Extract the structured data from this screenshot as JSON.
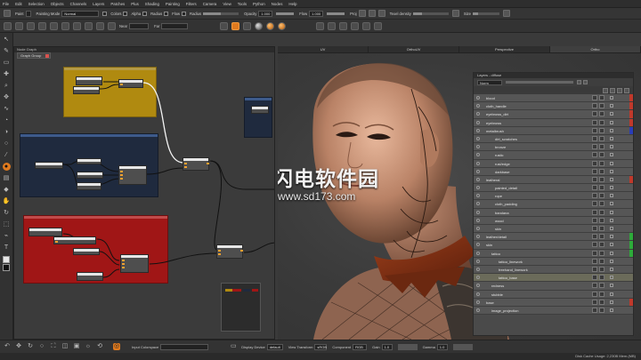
{
  "menu": [
    "File",
    "Edit",
    "Selection",
    "Objects",
    "Channels",
    "Layers",
    "Patches",
    "Plus",
    "Shading",
    "Painting",
    "Filters",
    "Camera",
    "View",
    "Tools",
    "Python",
    "Nodes",
    "Help"
  ],
  "toolbar": {
    "paint_label": "Paint",
    "paint_mode_label": "Painting Mode",
    "paint_mode_value": "Normal",
    "colors_label": "Colors",
    "alpha_label": "Alpha",
    "radius_label": "Radius",
    "flow_label": "Flow",
    "radius2_label": "Radius",
    "opacity_label": "Opacity",
    "opacity_value": "1.000",
    "flow2_label": "Flow",
    "flow_value": "1.000",
    "proj_label": "Proj",
    "texel_label": "Texel density",
    "size_label": "Size",
    "row2_labels": [
      "Near",
      "Far"
    ]
  },
  "graph": {
    "panel_title": "Node Graph",
    "tab_label": "Graph Group"
  },
  "viewport_tabs": [
    "UV",
    "OrthoUV",
    "Perspective",
    "Ortho"
  ],
  "layers_panel": {
    "title": "Layers - diffuse",
    "mode_value": "Norm",
    "rows": [
      {
        "name": "blood",
        "indent": 4,
        "strip": "#c0392b"
      },
      {
        "name": "cloth_handle",
        "indent": 4,
        "strip": "#c0392b"
      },
      {
        "name": "eyebrows_dirt",
        "indent": 4,
        "strip": "#c0392b"
      },
      {
        "name": "eyebrows",
        "indent": 4,
        "strip": "#c0392b"
      },
      {
        "name": "metalbrush",
        "indent": 4,
        "strip": "#2a3db8"
      },
      {
        "name": "dirt_scratches",
        "indent": 14,
        "strip": ""
      },
      {
        "name": "bronze",
        "indent": 14,
        "strip": ""
      },
      {
        "name": "rustic",
        "indent": 14,
        "strip": ""
      },
      {
        "name": "rust/edge",
        "indent": 14,
        "strip": ""
      },
      {
        "name": "darkbase",
        "indent": 14,
        "strip": ""
      },
      {
        "name": "leatheral",
        "indent": 4,
        "strip": "#c0392b"
      },
      {
        "name": "painted_detail",
        "indent": 14,
        "strip": ""
      },
      {
        "name": "rope",
        "indent": 14,
        "strip": ""
      },
      {
        "name": "cloth_padding",
        "indent": 14,
        "strip": ""
      },
      {
        "name": "bandana",
        "indent": 14,
        "strip": ""
      },
      {
        "name": "wood",
        "indent": 14,
        "strip": ""
      },
      {
        "name": "skin",
        "indent": 14,
        "strip": ""
      },
      {
        "name": "leather/detail",
        "indent": 4,
        "strip": "#2eaa3a"
      },
      {
        "name": "skin",
        "indent": 4,
        "strip": "#2eaa3a"
      },
      {
        "name": "tattoo",
        "indent": 10,
        "strip": "#2eaa3a"
      },
      {
        "name": "tattoo_linework",
        "indent": 18,
        "strip": ""
      },
      {
        "name": "freehand_linework",
        "indent": 18,
        "strip": ""
      },
      {
        "name": "tattoo_base",
        "indent": 18,
        "strip": "",
        "selected": true
      },
      {
        "name": "redness",
        "indent": 10,
        "strip": ""
      },
      {
        "name": "stubble",
        "indent": 10,
        "strip": ""
      },
      {
        "name": "base",
        "indent": 4,
        "strip": "#c0392b"
      },
      {
        "name": "image_projection",
        "indent": 10,
        "strip": ""
      }
    ]
  },
  "bottom_bar": {
    "input_colorspace_label": "Input Colorspace",
    "display_device_label": "Display Device",
    "display_device_value": "default",
    "view_transform_label": "View Transform",
    "view_transform_value": "sRGB",
    "component_label": "Component",
    "component_value": "RGB",
    "gain_label": "Gain",
    "gain_value": "1.0",
    "gamma_label": "Gamma",
    "gamma_value": "1.0"
  },
  "status_text": "Disk Cache Usage: 2,230B  Mem.(MB)",
  "watermark": {
    "text": "闪电软件园",
    "url": "www.sd173.com"
  },
  "colors": {
    "accent": "#e07a1e",
    "panel_bg": "#3b3b3b",
    "backdrop_yellow": "#b08a10",
    "backdrop_blue": "#1f2a3e",
    "backdrop_red": "#a01616"
  }
}
